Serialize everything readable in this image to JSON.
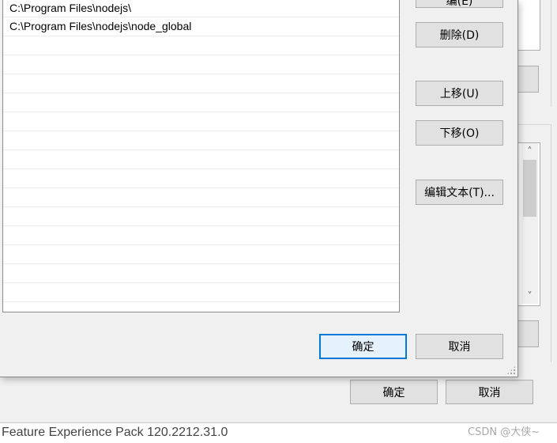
{
  "dialog": {
    "paths": [
      "C:\\Program Files\\nodejs\\",
      "C:\\Program Files\\nodejs\\node_global",
      "",
      "",
      "",
      "",
      "",
      "",
      "",
      "",
      "",
      "",
      "",
      "",
      "",
      ""
    ],
    "buttons": {
      "top_partial": "编(E)",
      "delete": "删除(D)",
      "move_up": "上移(U)",
      "move_down": "下移(O)",
      "edit_text": "编辑文本(T)...",
      "ok": "确定",
      "cancel": "取消"
    }
  },
  "background_window": {
    "ok": "确定",
    "cancel": "取消"
  },
  "status_bar": {
    "text": "Feature Experience Pack 120.2212.31.0"
  },
  "watermark": "CSDN @大侠~",
  "icons": {
    "scroll_up": "chevron-up-icon",
    "scroll_down": "chevron-down-icon",
    "resize": "resize-grip-icon"
  },
  "colors": {
    "accent": "#0078d7",
    "button_face": "#e1e1e1",
    "window_bg": "#f0f0f0"
  }
}
